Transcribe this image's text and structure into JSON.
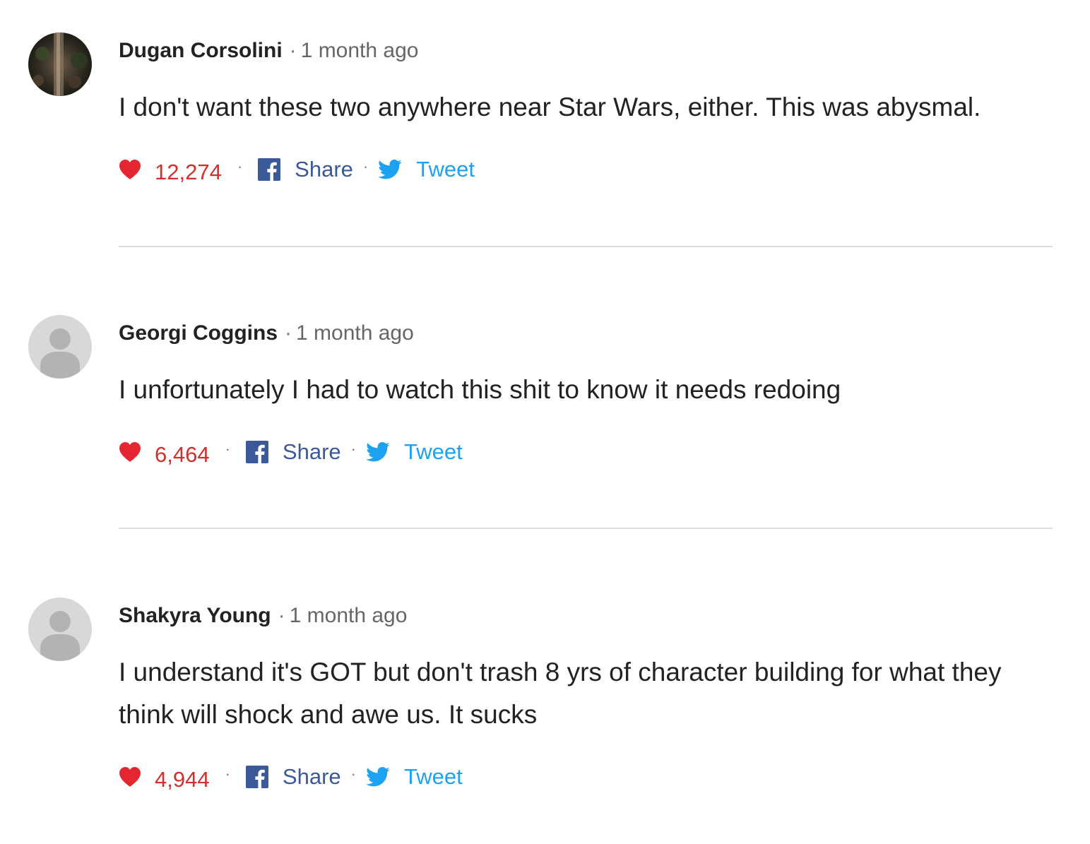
{
  "comments": [
    {
      "author": "Dugan Corsolini",
      "time": "1 month ago",
      "text": "I don't want these two anywhere near Star Wars, either. This was abysmal.",
      "likes": "12,274",
      "share_label": "Share",
      "tweet_label": "Tweet",
      "avatar": "photo-avatar"
    },
    {
      "author": "Georgi Coggins",
      "time": "1 month ago",
      "text": "I unfortunately I had to watch this shit to know it needs redoing",
      "likes": "6,464",
      "share_label": "Share",
      "tweet_label": "Tweet",
      "avatar": "default-avatar"
    },
    {
      "author": "Shakyra Young",
      "time": "1 month ago",
      "text": "I understand it's GOT but don't trash 8 yrs of character building for what they think will shock and awe us. It sucks",
      "likes": "4,944",
      "share_label": "Share",
      "tweet_label": "Tweet",
      "avatar": "default-avatar"
    }
  ],
  "separator": "·",
  "colors": {
    "like": "#d0312d",
    "facebook": "#3b5998",
    "twitter": "#1da1f2",
    "divider": "#dddddd",
    "avatar_placeholder_bg": "#d8d8d8",
    "avatar_placeholder_fg": "#b3b3b3"
  },
  "icons": {
    "like": "heart-icon",
    "share": "facebook-icon",
    "tweet": "twitter-icon"
  }
}
